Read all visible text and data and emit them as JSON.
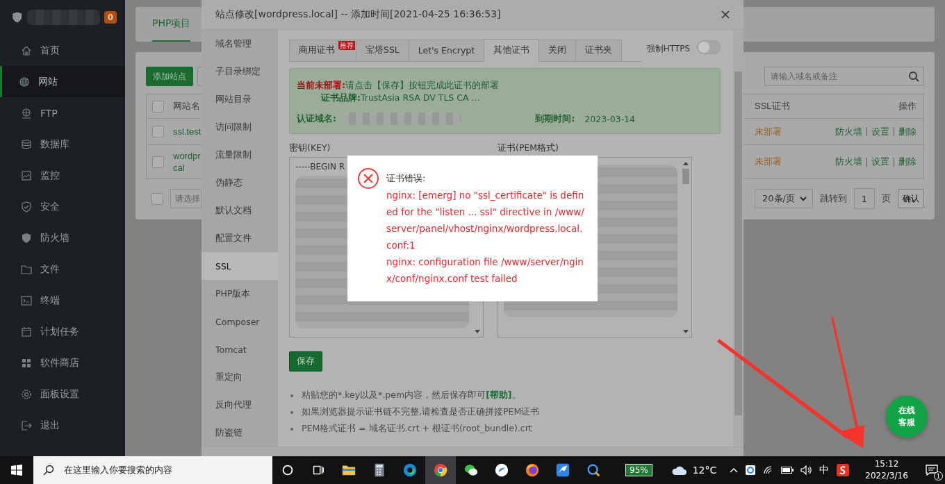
{
  "sidebar": {
    "badge": "0",
    "items": [
      {
        "label": "首页",
        "selected": false
      },
      {
        "label": "网站",
        "selected": true
      },
      {
        "label": "FTP",
        "selected": false
      },
      {
        "label": "数据库",
        "selected": false
      },
      {
        "label": "监控",
        "selected": false
      },
      {
        "label": "安全",
        "selected": false
      },
      {
        "label": "防火墙",
        "selected": false
      },
      {
        "label": "文件",
        "selected": false
      },
      {
        "label": "终端",
        "selected": false
      },
      {
        "label": "计划任务",
        "selected": false
      },
      {
        "label": "软件商店",
        "selected": false
      },
      {
        "label": "面板设置",
        "selected": false
      },
      {
        "label": "退出",
        "selected": false
      }
    ]
  },
  "page": {
    "tabs": [
      {
        "label": "PHP项目",
        "selected": true
      }
    ],
    "add_button": "添加站点",
    "search": {
      "placeholder": "请输入域名或备注"
    },
    "table": {
      "header_checked": false,
      "columns": [
        "网站名",
        "SSL证书",
        "操作"
      ],
      "rows": [
        {
          "checked": false,
          "name": [
            "ssl.test"
          ],
          "ssl": "未部署",
          "actions": [
            "防火墙",
            "设置",
            "删除"
          ]
        },
        {
          "checked": false,
          "name": [
            "wordpr",
            "cal"
          ],
          "ssl": "未部署",
          "actions": [
            "防火墙",
            "设置",
            "删除"
          ]
        }
      ]
    },
    "footer": {
      "checked": false,
      "batch_placeholder": "请选择",
      "page_size": "20条/页",
      "jump_label": "跳转到",
      "page_input": "1",
      "page_unit": "页",
      "confirm": "确认"
    }
  },
  "modal": {
    "title": "站点修改[wordpress.local] -- 添加时间[2021-04-25 16:36:53]",
    "menu": [
      {
        "label": "域名管理",
        "selected": false
      },
      {
        "label": "子目录绑定",
        "selected": false
      },
      {
        "label": "网站目录",
        "selected": false
      },
      {
        "label": "访问限制",
        "selected": false
      },
      {
        "label": "流量限制",
        "selected": false
      },
      {
        "label": "伪静态",
        "selected": false
      },
      {
        "label": "默认文档",
        "selected": false
      },
      {
        "label": "配置文件",
        "selected": false
      },
      {
        "label": "SSL",
        "selected": true
      },
      {
        "label": "PHP版本",
        "selected": false
      },
      {
        "label": "Composer",
        "selected": false
      },
      {
        "label": "Tomcat",
        "selected": false
      },
      {
        "label": "重定向",
        "selected": false
      },
      {
        "label": "反向代理",
        "selected": false
      },
      {
        "label": "防盗链",
        "selected": false
      }
    ],
    "ssl_tabs": [
      {
        "label": "商用证书",
        "selected": false,
        "ribbon": "推荐"
      },
      {
        "label": "宝塔SSL",
        "selected": false
      },
      {
        "label": "Let's Encrypt",
        "selected": false
      },
      {
        "label": "其他证书",
        "selected": true
      },
      {
        "label": "关闭",
        "selected": false
      },
      {
        "label": "证书夹",
        "selected": false
      }
    ],
    "force_https": {
      "label": "强制HTTPS",
      "on": false
    },
    "alert": {
      "status_label": "当前未部署:",
      "status_text": "请点击【保存】按钮完成此证书的部署",
      "brand_label": "证书品牌:",
      "brand": "TrustAsia RSA DV TLS CA ...",
      "domain_label": "认证域名:",
      "expiry_label": "到期时间:",
      "expiry": "2023-03-14"
    },
    "key_label": "密钥(KEY)",
    "key_text": "-----BEGIN R",
    "cert_label": "证书(PEM格式)",
    "save_button": "保存",
    "tips": [
      {
        "text": "粘贴您的*.key以及*.pem内容，然后保存即可",
        "link": "[帮助]",
        "after": "。"
      },
      {
        "text": "如果浏览器提示证书链不完整,请检查是否正确拼接PEM证书"
      },
      {
        "text": "PEM格式证书 = 域名证书.crt + 根证书(root_bundle).crt"
      }
    ]
  },
  "error_dialog": {
    "title": "证书错误:",
    "lines": [
      "nginx: [emerg] no \"ssl_certificate\" is defined for the \"listen ... ssl\" directive in /www/server/panel/vhost/nginx/wordpress.local.conf:1",
      "nginx: configuration file /www/server/nginx/conf/nginx.conf test failed"
    ]
  },
  "float_button": {
    "lines": [
      "在线",
      "客服"
    ]
  },
  "taskbar": {
    "search_placeholder": "在这里输入你要搜索的内容",
    "apps": [
      {
        "kind": "cortana",
        "selected": false
      },
      {
        "kind": "taskview",
        "selected": false
      },
      {
        "kind": "explorer",
        "selected": false
      },
      {
        "kind": "calculator",
        "selected": false
      },
      {
        "kind": "edge",
        "selected": false
      },
      {
        "kind": "chrome",
        "selected": true
      },
      {
        "kind": "wechat",
        "selected": false
      },
      {
        "kind": "bluecircle",
        "selected": false
      },
      {
        "kind": "firefox",
        "selected": false
      },
      {
        "kind": "bird",
        "selected": false
      },
      {
        "kind": "magnifier",
        "selected": false
      }
    ],
    "battery": "95%",
    "weather": "12°C",
    "ime": "中",
    "time": "15:12",
    "date": "2022/3/16",
    "notifications": "1"
  }
}
